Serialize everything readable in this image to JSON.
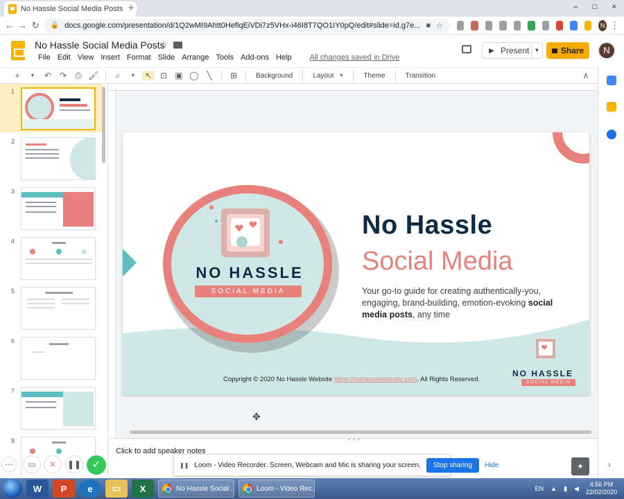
{
  "browser": {
    "tab_title": "No Hassle Social Media Posts - G",
    "tab_close": "×",
    "new_tab": "+",
    "url": "docs.google.com/presentation/d/1Q2wMI9Ahtt0HeflqEiVDi7z5VHx-i46I8T7QO1IY0pQ/edit#slide=id.g7e...",
    "profile_initial": "N",
    "window_controls": [
      "–",
      "□",
      "×"
    ]
  },
  "doc": {
    "title": "No Hassle Social Media Posts",
    "menu": [
      "File",
      "Edit",
      "View",
      "Insert",
      "Format",
      "Slide",
      "Arrange",
      "Tools",
      "Add-ons",
      "Help"
    ],
    "save_status": "All changes saved in Drive",
    "present_label": "Present",
    "share_label": "Share",
    "user_initial": "N"
  },
  "toolbar": {
    "background": "Background",
    "layout": "Layout",
    "theme": "Theme",
    "transition": "Transition"
  },
  "filmstrip": {
    "slide_numbers": [
      "1",
      "2",
      "3",
      "4",
      "5",
      "6",
      "7",
      "8"
    ]
  },
  "slide": {
    "title_line1": "No Hassle",
    "title_line2": "Social Media",
    "subtitle_pre": "Your go-to guide for creating authentically-you, engaging, brand-building, emotion-evoking ",
    "subtitle_bold": "social media posts",
    "subtitle_post": ", any time",
    "copyright_pre": "Copyright © 2020 No Hassle Website ",
    "copyright_link": "https://nohasslewebsite.com",
    "copyright_post": ". All Rights Reserved.",
    "logo_line1": "NO HASSLE",
    "logo_line2": "SOCIAL MEDIA"
  },
  "notes": {
    "placeholder": "Click to add speaker notes"
  },
  "loom": {
    "message": "Loom - Video Recorder: Screen, Webcam and Mic is sharing your screen.",
    "stop_label": "Stop sharing",
    "hide_label": "Hide"
  },
  "taskbar": {
    "task1": "No Hassle Social ...",
    "task2": "Loom - Video Rec...",
    "language": "EN",
    "time": "4:56 PM",
    "date": "22/02/2020"
  },
  "colors": {
    "navy": "#0e2a44",
    "coral": "#e8817c",
    "mint": "#cfe8e6",
    "teal": "#5fbfbf",
    "share_yellow": "#f9ab00"
  }
}
